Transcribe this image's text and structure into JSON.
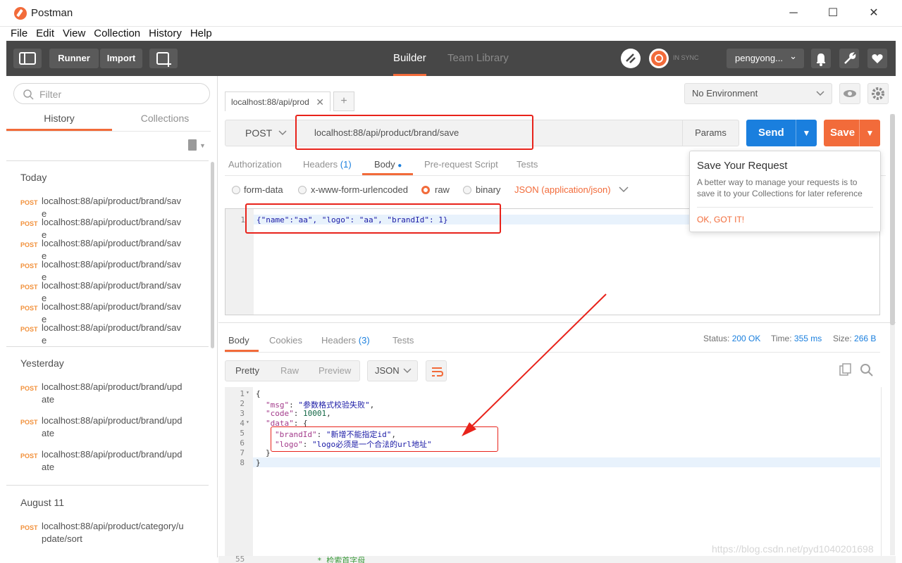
{
  "window": {
    "title": "Postman",
    "minimize": "─",
    "maximize": "☐",
    "close": "✕"
  },
  "menu": [
    "File",
    "Edit",
    "View",
    "Collection",
    "History",
    "Help"
  ],
  "toolbar": {
    "runner": "Runner",
    "import": "Import",
    "tab_builder": "Builder",
    "tab_team": "Team Library",
    "sync": "IN SYNC",
    "user": "pengyong...",
    "chevron": "⌄"
  },
  "sidebar": {
    "filter_placeholder": "Filter",
    "tab_history": "History",
    "tab_collections": "Collections",
    "sections": [
      {
        "label": "Today",
        "items": [
          {
            "method": "POST",
            "url": "localhost:88/api/product/brand/save"
          },
          {
            "method": "POST",
            "url": "localhost:88/api/product/brand/save"
          },
          {
            "method": "POST",
            "url": "localhost:88/api/product/brand/save"
          },
          {
            "method": "POST",
            "url": "localhost:88/api/product/brand/save"
          },
          {
            "method": "POST",
            "url": "localhost:88/api/product/brand/save"
          },
          {
            "method": "POST",
            "url": "localhost:88/api/product/brand/save"
          },
          {
            "method": "POST",
            "url": "localhost:88/api/product/brand/save"
          }
        ]
      },
      {
        "label": "Yesterday",
        "items": [
          {
            "method": "POST",
            "url": "localhost:88/api/product/brand/update"
          },
          {
            "method": "POST",
            "url": "localhost:88/api/product/brand/update"
          },
          {
            "method": "POST",
            "url": "localhost:88/api/product/brand/update"
          }
        ]
      },
      {
        "label": "August 11",
        "items": [
          {
            "method": "POST",
            "url": "localhost:88/api/product/category/update/sort"
          }
        ]
      }
    ]
  },
  "request": {
    "tab_label": "localhost:88/api/prod",
    "tab_close": "✕",
    "add_tab": "+",
    "environment": "No Environment",
    "method": "POST",
    "url": "localhost:88/api/product/brand/save",
    "params": "Params",
    "send": "Send",
    "save": "Save",
    "tabs": {
      "authorization": "Authorization",
      "headers": "Headers",
      "headers_count": "(1)",
      "body": "Body",
      "body_dot": "●",
      "prerequest": "Pre-request Script",
      "tests": "Tests"
    },
    "body_modes": {
      "form_data": "form-data",
      "urlencoded": "x-www-form-urlencoded",
      "raw": "raw",
      "binary": "binary",
      "content_type": "JSON (application/json)"
    },
    "body_line_number": "1",
    "body_text": "{\"name\":\"aa\", \"logo\": \"aa\", \"brandId\": 1}"
  },
  "popover": {
    "title": "Save Your Request",
    "body": "A better way to manage your requests is to save it to your Collections for later reference",
    "ok": "OK, GOT IT!"
  },
  "response": {
    "tabs": {
      "body": "Body",
      "cookies": "Cookies",
      "headers": "Headers",
      "headers_count": "(3)",
      "tests": "Tests"
    },
    "status_label": "Status:",
    "status_value": "200 OK",
    "time_label": "Time:",
    "time_value": "355 ms",
    "size_label": "Size:",
    "size_value": "266 B",
    "views": {
      "pretty": "Pretty",
      "raw": "Raw",
      "preview": "Preview"
    },
    "format": "JSON",
    "lines": [
      {
        "n": "1",
        "fold": "▾",
        "text": "{"
      },
      {
        "n": "2",
        "fold": "",
        "key": "\"msg\"",
        "sep": ": ",
        "val": "\"参数格式校验失败\"",
        "end": ","
      },
      {
        "n": "3",
        "fold": "",
        "key": "\"code\"",
        "sep": ": ",
        "num": "10001",
        "end": ","
      },
      {
        "n": "4",
        "fold": "▾",
        "key": "\"data\"",
        "sep": ": ",
        "end": "{"
      },
      {
        "n": "5",
        "fold": "",
        "key": "\"brandId\"",
        "sep": ": ",
        "val": "\"新增不能指定id\"",
        "end": ","
      },
      {
        "n": "6",
        "fold": "",
        "key": "\"logo\"",
        "sep": ": ",
        "val": "\"logo必须是一个合法的url地址\"",
        "end": ""
      },
      {
        "n": "7",
        "fold": "",
        "text": "}"
      },
      {
        "n": "8",
        "fold": "",
        "text": "}"
      }
    ]
  },
  "background_code": {
    "line": "55",
    "comment": "* 检索首字母"
  },
  "watermark": "https://blog.csdn.net/pyd1040201698",
  "colors": {
    "accent": "#f26b3a",
    "send": "#1a7fde",
    "toolbar": "#474747",
    "annotation": "#e8231b"
  }
}
